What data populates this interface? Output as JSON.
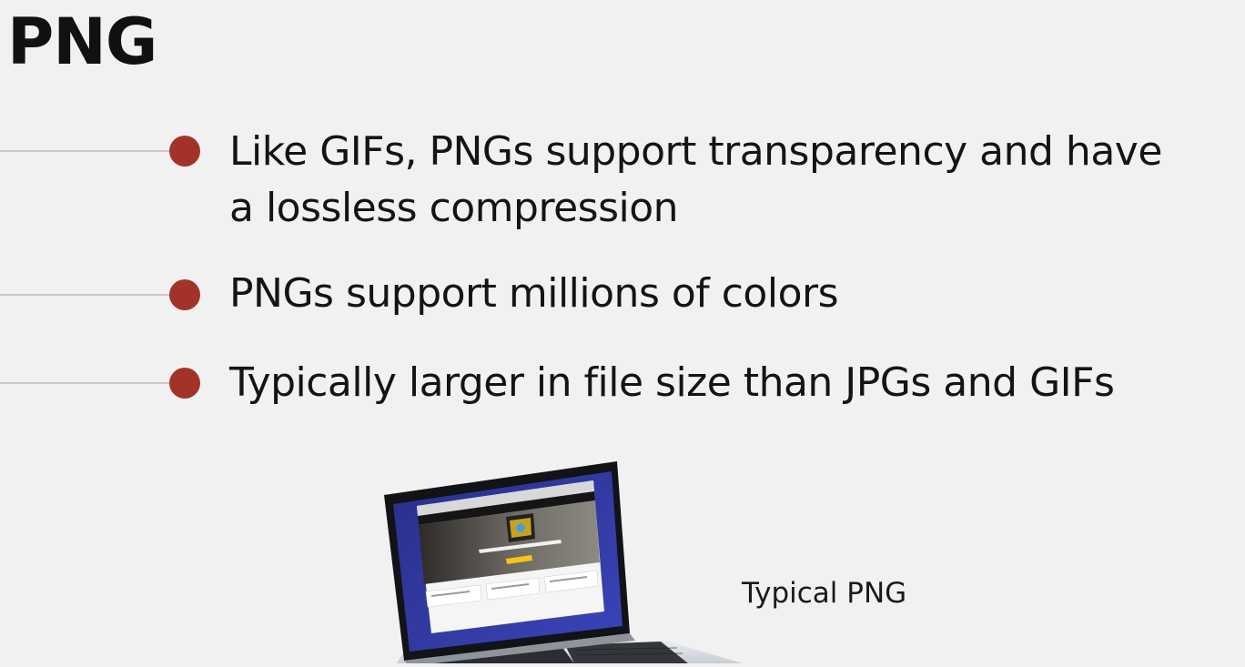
{
  "slide": {
    "title": "PNG"
  },
  "bullets": [
    {
      "lines": [
        "Like GIFs, PNGs support transparency and have",
        "a lossless compression"
      ]
    },
    {
      "lines": [
        "PNGs support millions of colors"
      ]
    },
    {
      "lines": [
        "Typically larger in file size than JPGs and GIFs"
      ]
    }
  ],
  "illustration": {
    "caption": "Typical PNG",
    "icon": "laptop-icon"
  },
  "colors": {
    "background": "#f1f1f1",
    "bullet": "#a33328",
    "connector": "#c8c8c8",
    "text": "#141414"
  }
}
